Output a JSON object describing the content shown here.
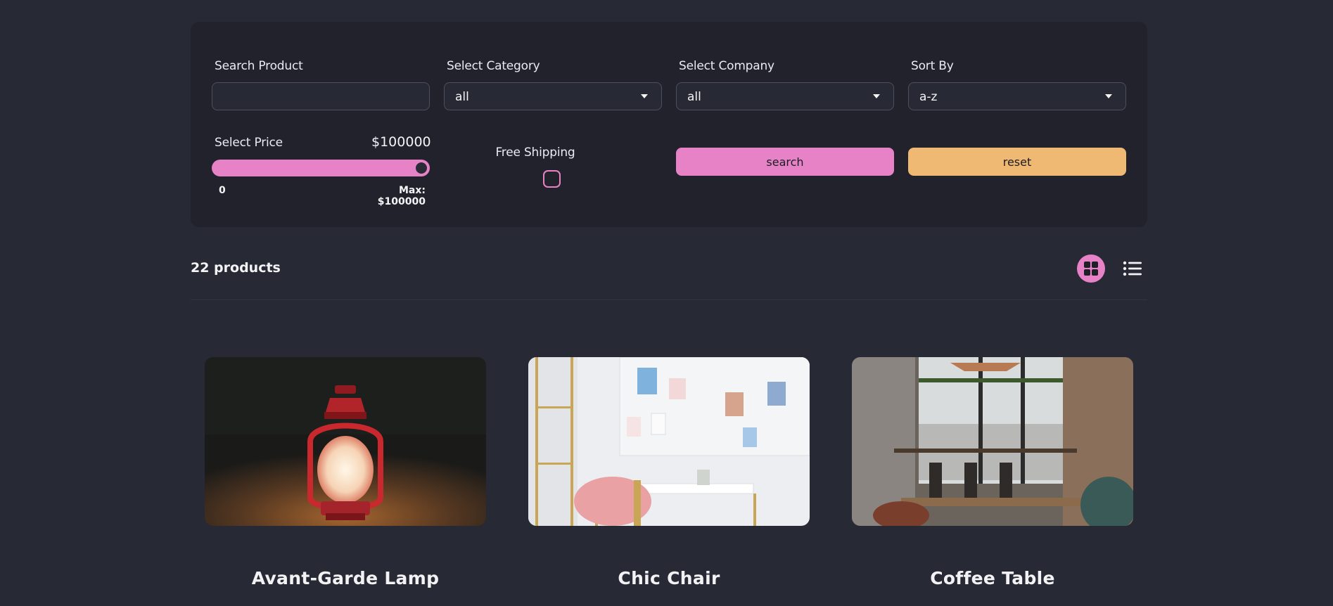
{
  "filters": {
    "search_label": "Search Product",
    "search_value": "",
    "category_label": "Select Category",
    "category_value": "all",
    "company_label": "Select Company",
    "company_value": "all",
    "sort_label": "Sort By",
    "sort_value": "a-z",
    "price_label": "Select Price",
    "price_value": "$100000",
    "price_min": "0",
    "price_max_label": "Max: $100000",
    "price_fraction": 1.0,
    "free_shipping_label": "Free Shipping",
    "free_shipping_checked": false,
    "search_button": "search",
    "reset_button": "reset"
  },
  "products_header": {
    "count_text": "22 products",
    "grid_icon": "grid-icon",
    "list_icon": "list-icon",
    "active_view": "grid"
  },
  "products": [
    {
      "title": "Avant-Garde Lamp",
      "image": "red-lantern-photo"
    },
    {
      "title": "Chic Chair",
      "image": "pink-chair-desk-photo"
    },
    {
      "title": "Coffee Table",
      "image": "cafe-interior-photo"
    }
  ],
  "colors": {
    "background": "#272935",
    "panel": "#21222c",
    "primary": "#e882c6",
    "secondary": "#efb974"
  }
}
